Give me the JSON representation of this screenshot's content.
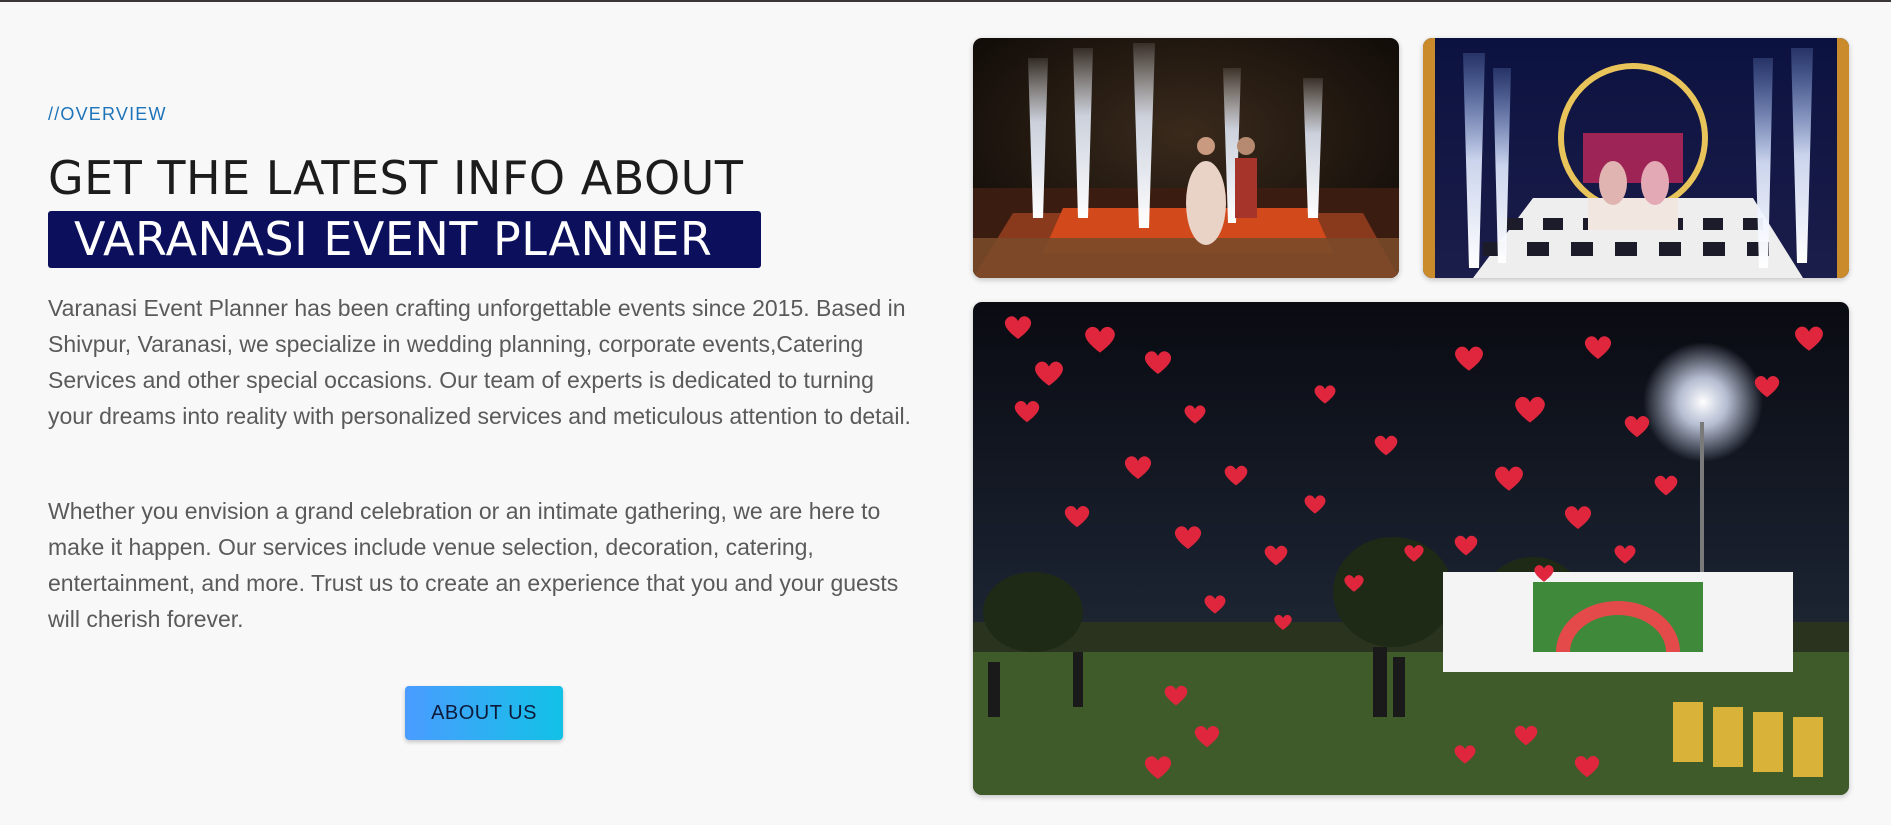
{
  "overview": {
    "eyebrow": "//OVERVIEW",
    "headline": "GET THE LATEST INFO ABOUT",
    "highlight": "VARANASI EVENT PLANNER",
    "paragraph1": "Varanasi Event Planner has been crafting unforgettable events since 2015. Based in Shivpur, Varanasi, we specialize in wedding planning, corporate events,Catering Services and other special occasions. Our team of experts is dedicated to turning your dreams into reality with personalized services and meticulous attention to detail.",
    "paragraph2": "Whether you envision a grand celebration or an intimate gathering, we are here to make it happen. Our services include venue selection, decoration, catering, entertainment, and more. Trust us to create an experience that you and your guests will cherish forever.",
    "button_label": "ABOUT US"
  },
  "colors": {
    "accent_blue": "#1e74b8",
    "highlight_bg": "#0b0f5c",
    "button_gradient_start": "#4a9cff",
    "button_gradient_end": "#12c2e6"
  },
  "gallery": {
    "photos": [
      {
        "name": "wedding-stage-fireworks-photo"
      },
      {
        "name": "wedding-couple-stage-sparklers-photo"
      },
      {
        "name": "red-heart-balloons-release-photo"
      }
    ]
  }
}
